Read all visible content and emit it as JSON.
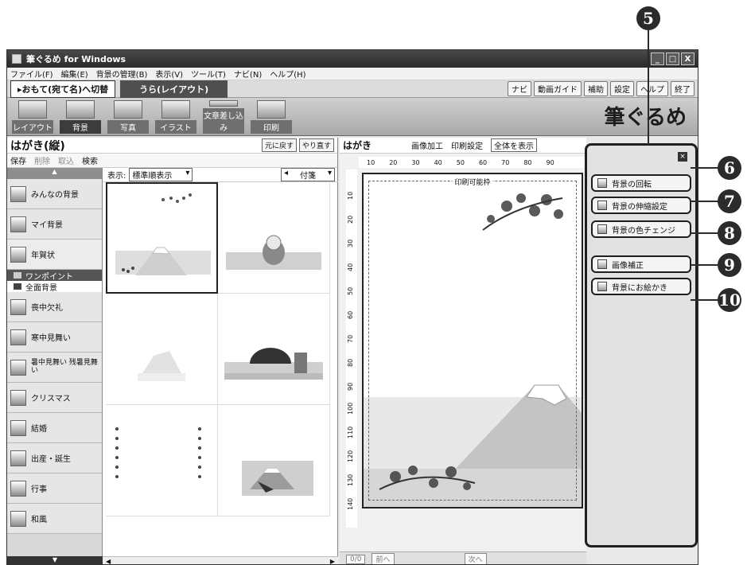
{
  "window": {
    "title": "筆ぐるめ for Windows",
    "controls": [
      "_",
      "□",
      "X"
    ]
  },
  "menu": [
    "ファイル(F)",
    "編集(E)",
    "背景の管理(B)",
    "表示(V)",
    "ツール(T)",
    "ナビ(N)",
    "ヘルプ(H)"
  ],
  "tabs": {
    "front": "▸おもて(宛て名)へ切替",
    "back": "うら(レイアウト)"
  },
  "top_tools": [
    "ナビ",
    "動画ガイド",
    "補助",
    "設定",
    "ヘルプ",
    "終了"
  ],
  "ribbon": {
    "buttons": [
      "レイアウト",
      "背景",
      "写真",
      "イラスト",
      "文章差し込み",
      "印刷"
    ],
    "brand": "筆ぐるめ"
  },
  "left_pane": {
    "title": "はがき(縦)",
    "undo": "元に戻す",
    "redo": "やり直す",
    "tools": [
      "保存",
      "削除",
      "取込",
      "検索"
    ],
    "sort_label": "表示:",
    "sort_value": "標準順表示",
    "order_value": "付箋",
    "categories": [
      "みんなの背景",
      "マイ背景",
      "年賀状"
    ],
    "subcategories": [
      "ワンポイント",
      "全面背景"
    ],
    "categories_more": [
      "喪中欠礼",
      "寒中見舞い",
      "暑中見舞い 残暑見舞い",
      "クリスマス",
      "結婚",
      "出産・誕生",
      "行事",
      "和風"
    ]
  },
  "mid_pane": {
    "title": "はがき",
    "image_edit": "画像加工",
    "print_setting": "印刷設定",
    "zoom": "全体を表示",
    "ruler_h": [
      "10",
      "20",
      "30",
      "40",
      "50",
      "60",
      "70",
      "80",
      "90"
    ],
    "ruler_v": [
      "10",
      "20",
      "30",
      "40",
      "50",
      "60",
      "70",
      "80",
      "90",
      "100",
      "110",
      "120",
      "130",
      "140"
    ],
    "print_area_label": "印刷可能枠",
    "page_counter": "0/0",
    "prev": "前へ",
    "next": "次へ"
  },
  "task_panel": {
    "close": "×",
    "buttons": [
      "背景の回転",
      "背景の伸縮設定",
      "背景の色チェンジ",
      "画像補正",
      "背景にお絵かき"
    ]
  },
  "callouts": [
    "5",
    "6",
    "7",
    "8",
    "9",
    "10"
  ]
}
